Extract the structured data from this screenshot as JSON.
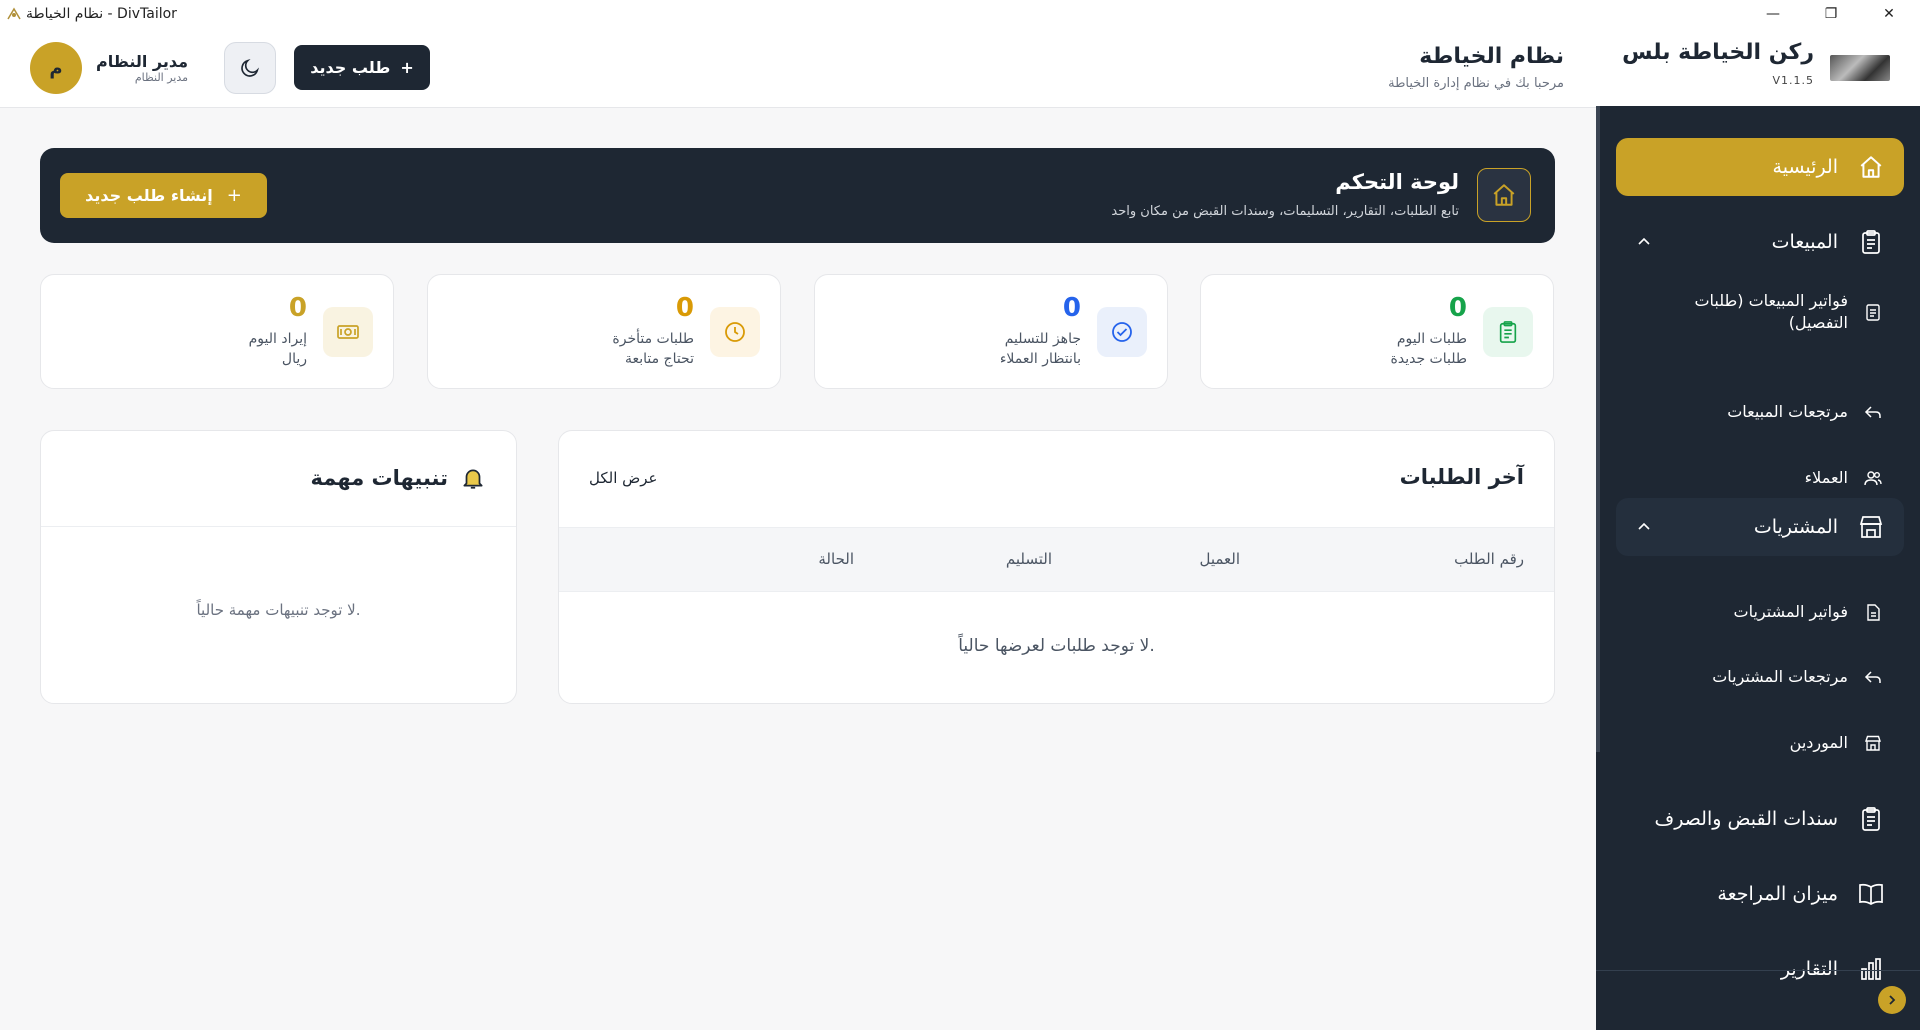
{
  "window": {
    "title": "نظام الخياطة - DivTailor",
    "minimize": "—",
    "maximize": "❐",
    "close": "✕"
  },
  "brand": {
    "name": "ركن الخياطة بلس",
    "version": "V1.1.5"
  },
  "sidebar": {
    "home": "الرئيسية",
    "sales": {
      "label": "المبيعات",
      "items": [
        "فواتير المبيعات (طلبات التفصيل)",
        "مرتجعات المبيعات",
        "العملاء"
      ]
    },
    "purchases": {
      "label": "المشتريات",
      "items": [
        "فواتير المشتريات",
        "مرتجعات المشتريات",
        "الموردين"
      ]
    },
    "vouchers": "سندات القبض والصرف",
    "trial_balance": "ميزان المراجعة",
    "reports": "التقارير"
  },
  "topbar": {
    "title": "نظام الخياطة",
    "subtitle": "مرحبا بك في نظام إدارة الخياطة",
    "new_order": "طلب جديد",
    "user_name": "مدير النظام",
    "user_role": "مدير النظام",
    "avatar_initial": "م"
  },
  "hero": {
    "title": "لوحة التحكم",
    "subtitle": "تابع الطلبات، التقارير، التسليمات، وسندات القبض من مكان واحد",
    "cta": "إنشاء طلب جديد"
  },
  "stats": [
    {
      "value": "0",
      "line1": "طلبات اليوم",
      "line2": "طلبات جديدة",
      "color": "#16a34a"
    },
    {
      "value": "0",
      "line1": "جاهز للتسليم",
      "line2": "بانتظار العملاء",
      "color": "#2563eb"
    },
    {
      "value": "0",
      "line1": "طلبات متأخرة",
      "line2": "تحتاج متابعة",
      "color": "#d99a06"
    },
    {
      "value": "0",
      "line1": "إيراد اليوم",
      "line2": "ريال",
      "color": "#c9a227"
    }
  ],
  "orders": {
    "title": "آخر الطلبات",
    "view_all": "عرض الكل",
    "columns": [
      "رقم الطلب",
      "العميل",
      "التسليم",
      "الحالة"
    ],
    "empty": "لا توجد طلبات لعرضها حالياً."
  },
  "alerts": {
    "title": "تنبيهات مهمة",
    "empty": "لا توجد تنبيهات مهمة حالياً."
  },
  "colors": {
    "accent": "#c9a227",
    "dark": "#1e2733"
  }
}
